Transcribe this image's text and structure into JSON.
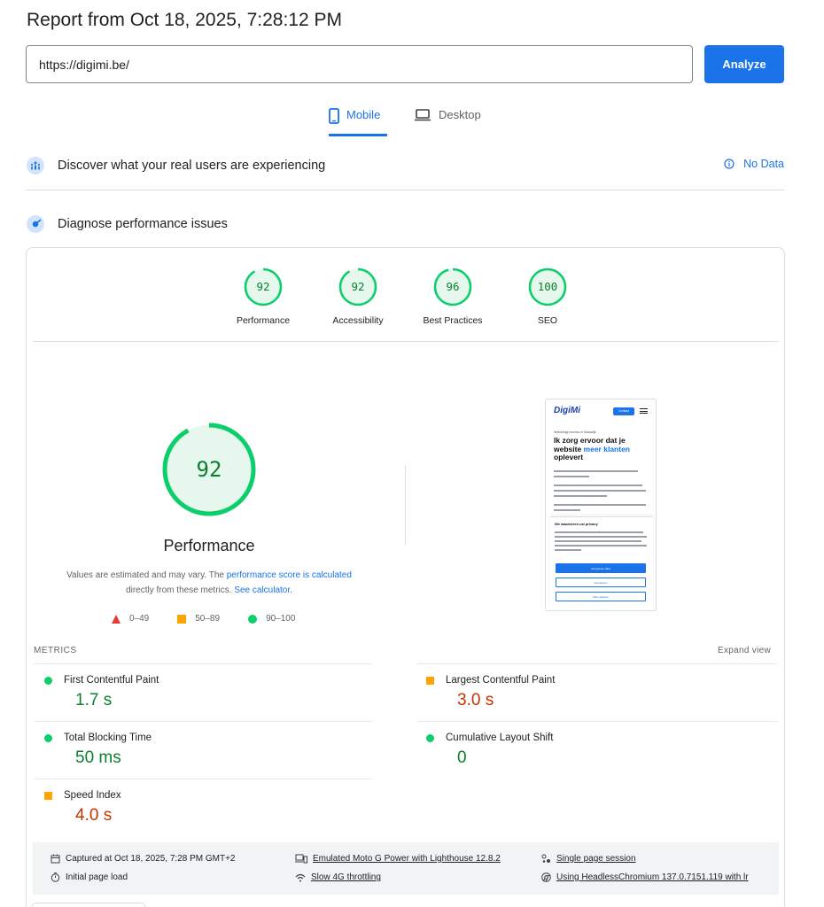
{
  "report": {
    "title": "Report from Oct 18, 2025, 7:28:12 PM"
  },
  "search": {
    "url": "https://digimi.be/",
    "analyze_label": "Analyze"
  },
  "tabs": [
    {
      "label": "Mobile"
    },
    {
      "label": "Desktop"
    }
  ],
  "field_data": {
    "label": "Discover what your real users are experiencing",
    "status": "No Data"
  },
  "lab": {
    "label": "Diagnose performance issues",
    "categories": [
      {
        "label": "Performance",
        "score": "92"
      },
      {
        "label": "Accessibility",
        "score": "92"
      },
      {
        "label": "Best Practices",
        "score": "96"
      },
      {
        "label": "SEO",
        "score": "100"
      }
    ],
    "main_score": "92",
    "main_label": "Performance",
    "note_prefix": "Values are estimated and may vary. The ",
    "note_link1": "performance score is calculated",
    "note_middle": "directly from these metrics. ",
    "note_link2": "See calculator.",
    "legend": {
      "poor": "0–49",
      "average": "50–89",
      "good": "90–100"
    },
    "colors": {
      "good": "#0cce6b",
      "average": "#ffa400",
      "poor": "#ff4e42",
      "good_text": "#0c7e2f",
      "average_text": "#c33300"
    }
  },
  "screenshot": {
    "logo": "DigiMi",
    "contact": "Contact",
    "tagline": "Webdesign bureau in Maasdijk",
    "headline_a": "Ik zorg ervoor dat je website ",
    "headline_b": "meer klanten",
    "headline_c": " oplevert",
    "privacy_title": "We waarderen uw privacy",
    "btn_accept": "Accepteren alles",
    "btn_custom": "Aanpassen",
    "btn_reject": "Alles afwijzen"
  },
  "metrics": {
    "heading": "METRICS",
    "expand": "Expand view",
    "items": [
      {
        "label": "First Contentful Paint",
        "value": "1.7 s",
        "rating": "good"
      },
      {
        "label": "Largest Contentful Paint",
        "value": "3.0 s",
        "rating": "average"
      },
      {
        "label": "Total Blocking Time",
        "value": "50 ms",
        "rating": "good"
      },
      {
        "label": "Cumulative Layout Shift",
        "value": "0",
        "rating": "good"
      },
      {
        "label": "Speed Index",
        "value": "4.0 s",
        "rating": "average"
      }
    ]
  },
  "footer": {
    "captured": "Captured at Oct 18, 2025, 7:28 PM GMT+2",
    "initial_load": "Initial page load",
    "device": "Emulated Moto G Power with Lighthouse 12.8.2",
    "throttling": "Slow 4G throttling",
    "session": "Single page session",
    "browser": "Using HeadlessChromium 137.0.7151.119 with lr"
  }
}
